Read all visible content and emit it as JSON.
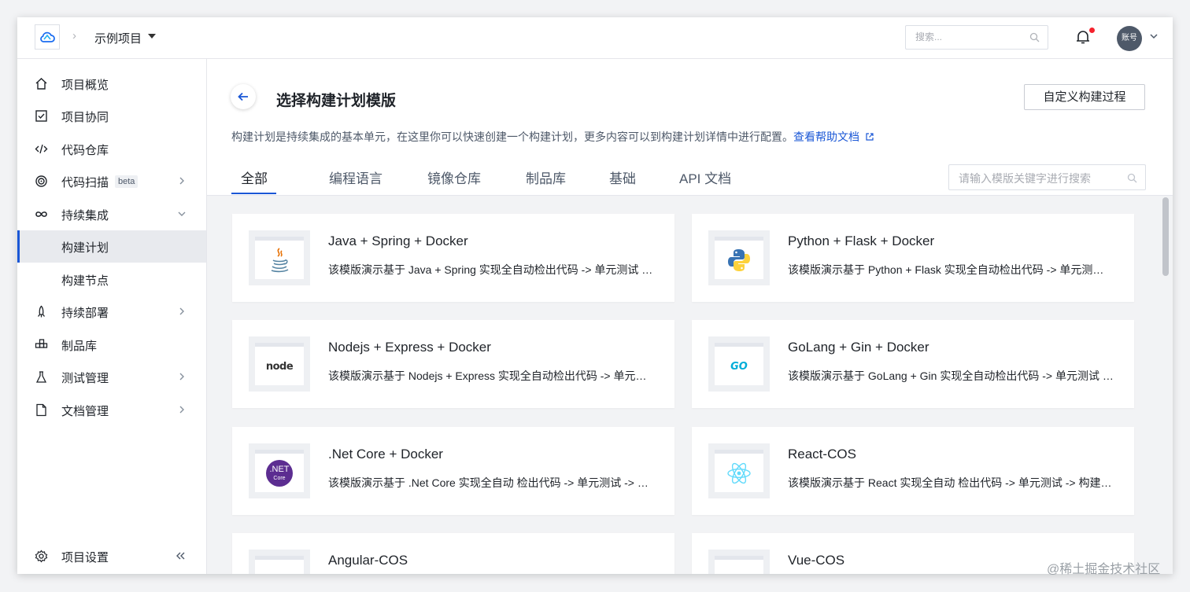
{
  "header": {
    "project_name": "示例项目",
    "search_placeholder": "搜索...",
    "avatar_label": "账号"
  },
  "sidebar": {
    "items": [
      {
        "label": "项目概览",
        "icon": "home-icon"
      },
      {
        "label": "项目协同",
        "icon": "checkbox-icon"
      },
      {
        "label": "代码仓库",
        "icon": "code-icon"
      },
      {
        "label": "代码扫描",
        "icon": "scan-icon",
        "badge": "beta"
      },
      {
        "label": "持续集成",
        "icon": "infinity-icon"
      },
      {
        "label": "构建计划"
      },
      {
        "label": "构建节点"
      },
      {
        "label": "持续部署",
        "icon": "rocket-icon"
      },
      {
        "label": "制品库",
        "icon": "package-icon"
      },
      {
        "label": "测试管理",
        "icon": "flask-icon"
      },
      {
        "label": "文档管理",
        "icon": "document-icon"
      }
    ],
    "settings_label": "项目设置"
  },
  "main": {
    "title": "选择构建计划模版",
    "custom_button": "自定义构建过程",
    "description": "构建计划是持续集成的基本单元，在这里你可以快速创建一个构建计划，更多内容可以到构建计划详情中进行配置。",
    "help_link": "查看帮助文档",
    "tabs": [
      "全部",
      "编程语言",
      "镜像仓库",
      "制品库",
      "基础",
      "API 文档"
    ],
    "template_search_placeholder": "请输入模版关键字进行搜索",
    "cards": [
      {
        "title": "Java + Spring + Docker",
        "desc": "该模版演示基于 Java + Spring 实现全自动检出代码 -> 单元测试 -> 编译 -> 构建镜像 -> 推送镜像",
        "logo": "java-logo-icon"
      },
      {
        "title": "Python + Flask + Docker",
        "desc": "该模版演示基于 Python + Flask 实现全自动检出代码 -> 单元测试 -> 构建镜像 -> 推送镜像",
        "logo": "python-logo-icon"
      },
      {
        "title": "Nodejs + Express + Docker",
        "desc": "该模版演示基于 Nodejs + Express 实现全自动检出代码 -> 单元测试 -> 构建镜像 -> 推送镜像",
        "logo": "node-logo-icon",
        "logo_text": "node"
      },
      {
        "title": "GoLang + Gin + Docker",
        "desc": "该模版演示基于 GoLang + Gin 实现全自动检出代码 -> 单元测试 -> 编译 -> 构建镜像 -> 推送镜像",
        "logo": "go-logo-icon",
        "logo_text": "GO"
      },
      {
        "title": ".Net Core + Docker",
        "desc": "该模版演示基于 .Net Core 实现全自动 检出代码 -> 单元测试 -> 构建镜像 -> 推送镜像",
        "logo": "dotnet-logo-icon",
        "logo_text": ".NET",
        "logo_subtext": "Core"
      },
      {
        "title": "React-COS",
        "desc": "该模版演示基于 React 实现全自动 检出代码 -> 单元测试 -> 构建 -> 上传到 COS",
        "logo": "react-logo-icon"
      },
      {
        "title": "Angular-COS",
        "desc": "",
        "logo": ""
      },
      {
        "title": "Vue-COS",
        "desc": "",
        "logo": ""
      }
    ]
  },
  "watermark": "@稀土掘金技术社区",
  "colors": {
    "accent": "#1a57d6",
    "notification": "#f5222d",
    "active_bg": "#e8eaee"
  }
}
